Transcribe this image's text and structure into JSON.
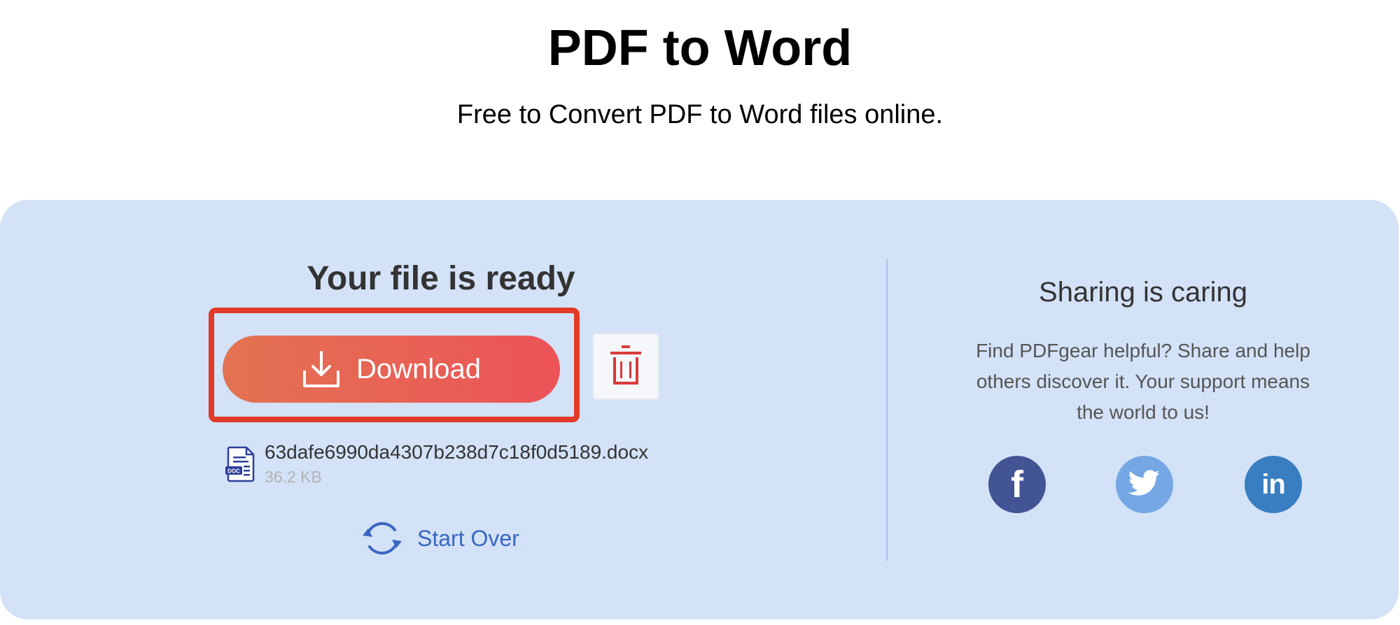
{
  "header": {
    "title": "PDF to Word",
    "subtitle": "Free to Convert PDF to Word files online."
  },
  "result": {
    "title": "Your file is ready",
    "download_label": "Download",
    "download_icon": "download-icon",
    "delete_icon": "trash-icon",
    "file": {
      "name": "63dafe6990da4307b238d7c18f0d5189.docx",
      "size": "36.2 KB",
      "icon": "docx-file-icon",
      "icon_badge": "DOC"
    },
    "start_over_label": "Start Over",
    "start_over_icon": "refresh-icon"
  },
  "share": {
    "title": "Sharing is caring",
    "text": "Find PDFgear helpful? Share and help others discover it. Your support means the world to us!",
    "networks": [
      {
        "name": "facebook",
        "glyph": "f",
        "color": "#435494"
      },
      {
        "name": "twitter",
        "glyph": "twitter-bird-icon",
        "color": "#74a7e4"
      },
      {
        "name": "linkedin",
        "glyph": "in",
        "color": "#397ec1"
      }
    ]
  },
  "colors": {
    "panel_bg": "#d3e2f7",
    "download_gradient_start": "#e37352",
    "download_gradient_end": "#ec5358",
    "highlight_border": "#e23a28",
    "accent_blue": "#3a66c4",
    "delete_red": "#d93a3a"
  }
}
